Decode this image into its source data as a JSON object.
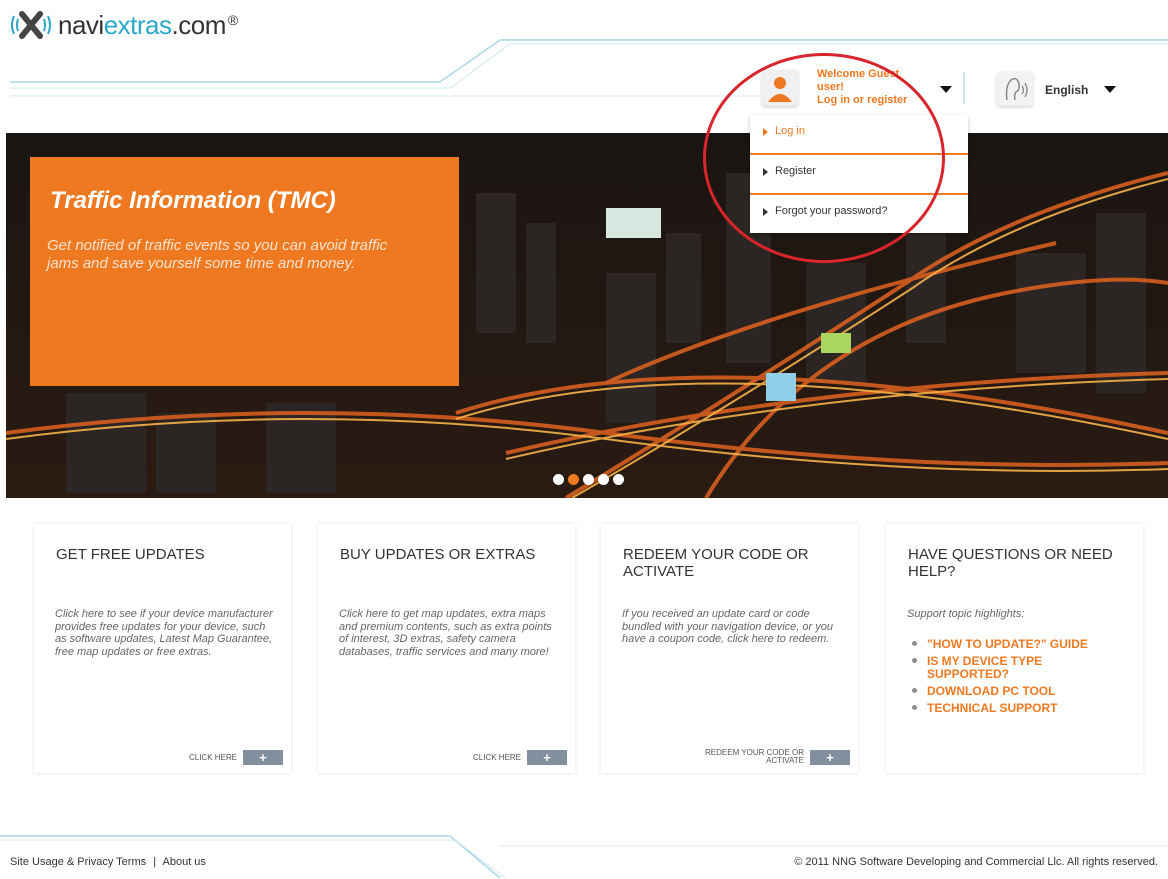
{
  "brand": {
    "logo_text_prefix": "navi",
    "logo_text_accent": "extras",
    "logo_text_suffix": ".com",
    "logo_reg": "®",
    "accent_color": "#ef7921",
    "teal_color": "#2aa7c9"
  },
  "user_menu": {
    "welcome_line1": "Welcome Guest",
    "welcome_line2": "user!",
    "welcome_line3": "Log in or register",
    "items": [
      {
        "label": "Log in"
      },
      {
        "label": "Register"
      },
      {
        "label": "Forgot your password?"
      }
    ]
  },
  "language": {
    "selected": "English"
  },
  "hero": {
    "title": "Traffic Information (TMC)",
    "text": "Get notified of traffic events so you can avoid traffic jams and save yourself some time and money.",
    "slide_count": 5,
    "active_slide": 1
  },
  "cards": [
    {
      "title": "GET FREE UPDATES",
      "body": "Click here to see if your device manufacturer provides free updates for your device, such as software updates, Latest Map Guarantee, free map updates or free extras.",
      "action_label": "CLICK HERE",
      "action_icon": "+"
    },
    {
      "title": "BUY UPDATES OR EXTRAS",
      "body": " Click here to get map updates, extra maps and premium contents, such as extra points of interest, 3D extras, safety camera databases, traffic services and many more!",
      "action_label": "CLICK HERE",
      "action_icon": "+"
    },
    {
      "title": "REDEEM YOUR CODE OR ACTIVATE",
      "body": "If you received an update card or code bundled with your navigation device, or you have a coupon code, click here to redeem.",
      "action_label_line1": "REDEEM YOUR CODE OR",
      "action_label_line2": "ACTIVATE",
      "action_icon": "+"
    },
    {
      "title": "HAVE QUESTIONS OR NEED HELP?",
      "body": "Support topic highlights:",
      "links": [
        "\"HOW TO UPDATE?\" GUIDE",
        "IS MY DEVICE TYPE SUPPORTED?",
        "DOWNLOAD PC TOOL",
        "TECHNICAL SUPPORT"
      ]
    }
  ],
  "footer": {
    "privacy": "Site Usage & Privacy Terms",
    "separator": "|",
    "about": "About us",
    "copyright": "© 2011 NNG Software Developing and Commercial Llc. All rights reserved."
  }
}
